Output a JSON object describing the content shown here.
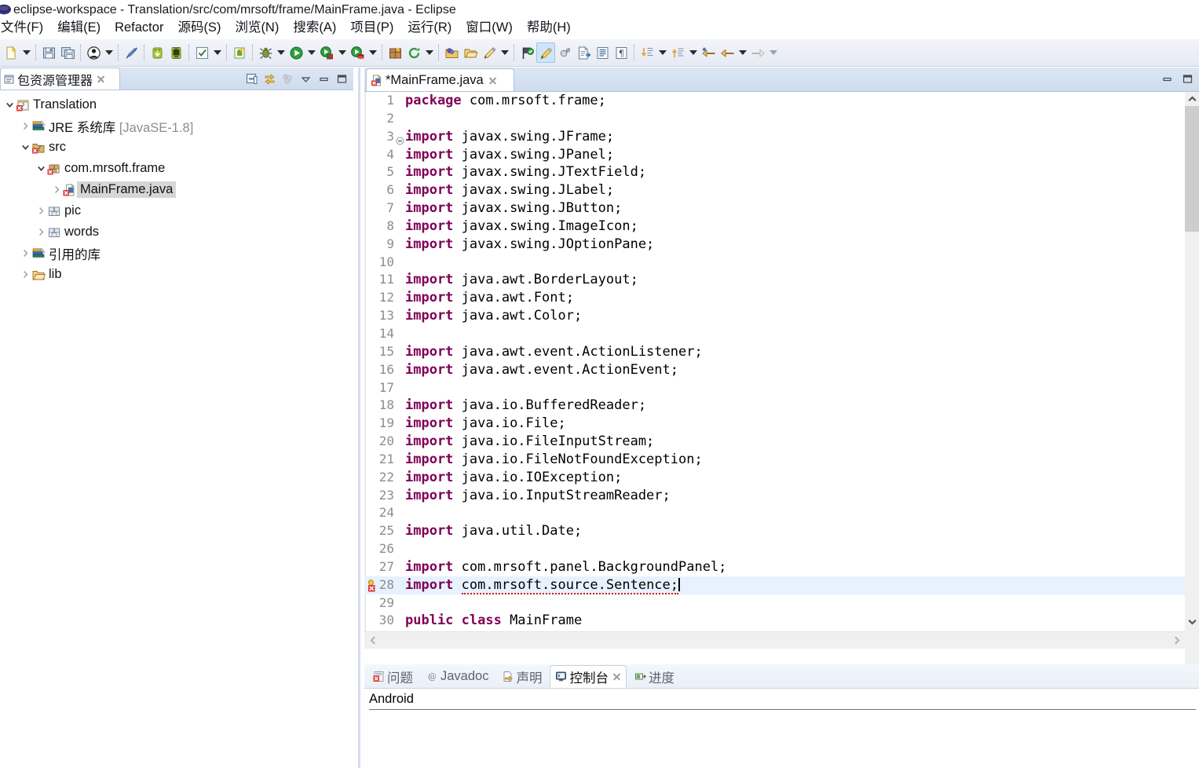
{
  "window": {
    "title": "eclipse-workspace - Translation/src/com/mrsoft/frame/MainFrame.java - Eclipse",
    "logo_icon": "eclipse-logo-icon"
  },
  "menubar": {
    "items": [
      {
        "label": "文件(F)",
        "name": "menu-file"
      },
      {
        "label": "编辑(E)",
        "name": "menu-edit"
      },
      {
        "label": "Refactor",
        "name": "menu-refactor"
      },
      {
        "label": "源码(S)",
        "name": "menu-source"
      },
      {
        "label": "浏览(N)",
        "name": "menu-navigate"
      },
      {
        "label": "搜索(A)",
        "name": "menu-search"
      },
      {
        "label": "项目(P)",
        "name": "menu-project"
      },
      {
        "label": "运行(R)",
        "name": "menu-run"
      },
      {
        "label": "窗口(W)",
        "name": "menu-window"
      },
      {
        "label": "帮助(H)",
        "name": "menu-help"
      }
    ]
  },
  "toolbar": {
    "items": [
      {
        "name": "new-wizard-icon",
        "kind": "icon",
        "icon": "new-file"
      },
      {
        "name": "new-wizard-dropdown",
        "kind": "arrow"
      },
      {
        "name": "sep-1",
        "kind": "sep"
      },
      {
        "name": "save-icon",
        "kind": "icon",
        "icon": "save"
      },
      {
        "name": "save-all-icon",
        "kind": "icon",
        "icon": "save-all"
      },
      {
        "name": "sep-2",
        "kind": "sep"
      },
      {
        "name": "person-icon",
        "kind": "icon",
        "icon": "person"
      },
      {
        "name": "person-dropdown",
        "kind": "arrow"
      },
      {
        "name": "sep-3",
        "kind": "sep"
      },
      {
        "name": "no-pencil-icon",
        "kind": "icon",
        "icon": "pencil-strike"
      },
      {
        "name": "sep-4",
        "kind": "sep"
      },
      {
        "name": "android-sdk-manager-icon",
        "kind": "icon",
        "icon": "android-down"
      },
      {
        "name": "android-avd-manager-icon",
        "kind": "icon",
        "icon": "android-device"
      },
      {
        "name": "sep-5",
        "kind": "sep"
      },
      {
        "name": "check-icon",
        "kind": "icon",
        "icon": "checkbox"
      },
      {
        "name": "check-dropdown",
        "kind": "arrow"
      },
      {
        "name": "sep-6",
        "kind": "sep"
      },
      {
        "name": "new-android-icon",
        "kind": "icon",
        "icon": "new-android"
      },
      {
        "name": "sep-7",
        "kind": "sep"
      },
      {
        "name": "debug-icon",
        "kind": "icon",
        "icon": "bug"
      },
      {
        "name": "debug-dropdown",
        "kind": "arrow"
      },
      {
        "name": "run-icon",
        "kind": "icon",
        "icon": "run"
      },
      {
        "name": "run-dropdown",
        "kind": "arrow"
      },
      {
        "name": "run-external-icon",
        "kind": "icon",
        "icon": "run-green-red"
      },
      {
        "name": "run-external-dropdown",
        "kind": "arrow"
      },
      {
        "name": "run-server-icon",
        "kind": "icon",
        "icon": "run-green-db"
      },
      {
        "name": "run-server-dropdown",
        "kind": "arrow"
      },
      {
        "name": "sep-8",
        "kind": "sep"
      },
      {
        "name": "new-package-icon",
        "kind": "icon",
        "icon": "package-box"
      },
      {
        "name": "refresh-icon",
        "kind": "icon",
        "icon": "refresh-green"
      },
      {
        "name": "refresh-dropdown",
        "kind": "arrow"
      },
      {
        "name": "sep-9",
        "kind": "sep"
      },
      {
        "name": "open-type-icon",
        "kind": "icon",
        "icon": "folder-ball"
      },
      {
        "name": "open-task-icon",
        "kind": "icon",
        "icon": "folder-open"
      },
      {
        "name": "pencil-icon",
        "kind": "icon",
        "icon": "pencil"
      },
      {
        "name": "pencil-dropdown",
        "kind": "arrow"
      },
      {
        "name": "sep-10",
        "kind": "sep"
      },
      {
        "name": "search-type-icon",
        "kind": "icon",
        "icon": "flag-green"
      },
      {
        "name": "marker-icon",
        "kind": "icon",
        "icon": "marker",
        "selected": true
      },
      {
        "name": "toggle-mark-icon",
        "kind": "icon",
        "icon": "toggle-mark"
      },
      {
        "name": "next-annotation-icon",
        "kind": "icon",
        "icon": "doc-arrow"
      },
      {
        "name": "show-whitespace-icon",
        "kind": "icon",
        "icon": "doc-lines"
      },
      {
        "name": "pilcrow-icon",
        "kind": "icon",
        "icon": "pilcrow"
      },
      {
        "name": "sep-11",
        "kind": "sep"
      },
      {
        "name": "next-member-icon",
        "kind": "icon",
        "icon": "down-arrow-list"
      },
      {
        "name": "next-member-dropdown",
        "kind": "arrow"
      },
      {
        "name": "prev-member-icon",
        "kind": "icon",
        "icon": "up-arrow-list"
      },
      {
        "name": "prev-member-dropdown",
        "kind": "arrow"
      },
      {
        "name": "last-edit-icon",
        "kind": "icon",
        "icon": "back-star"
      },
      {
        "name": "back-icon",
        "kind": "icon",
        "icon": "back-arrow"
      },
      {
        "name": "back-dropdown",
        "kind": "arrow"
      },
      {
        "name": "forward-icon",
        "kind": "icon",
        "icon": "forward-arrow-gray"
      },
      {
        "name": "forward-dropdown",
        "kind": "arrow-light"
      }
    ]
  },
  "sidebar": {
    "tab": {
      "label": "包资源管理器",
      "icon": "package-explorer-icon"
    },
    "view_tools": [
      {
        "name": "collapse-all-icon"
      },
      {
        "name": "link-with-editor-icon"
      },
      {
        "name": "focus-on-active-task-icon"
      },
      {
        "name": "view-menu-icon"
      },
      {
        "name": "minimize-icon"
      },
      {
        "name": "maximize-icon"
      }
    ],
    "tree": [
      {
        "label": "Translation",
        "suffix": "",
        "indent": 0,
        "twisty": "down",
        "icon": "java-project-icon",
        "selected": false
      },
      {
        "label": "JRE 系统库 ",
        "suffix": "[JavaSE-1.8]",
        "indent": 1,
        "twisty": "right",
        "icon": "library-icon",
        "selected": false
      },
      {
        "label": "src",
        "suffix": "",
        "indent": 1,
        "twisty": "down",
        "icon": "source-folder-icon",
        "selected": false
      },
      {
        "label": "com.mrsoft.frame",
        "suffix": "",
        "indent": 2,
        "twisty": "down",
        "icon": "package-icon",
        "selected": false
      },
      {
        "label": "MainFrame.java",
        "suffix": "",
        "indent": 3,
        "twisty": "right",
        "icon": "java-file-error-icon",
        "selected": true
      },
      {
        "label": "pic",
        "suffix": "",
        "indent": 2,
        "twisty": "right",
        "icon": "folder-pkg-icon",
        "selected": false
      },
      {
        "label": "words",
        "suffix": "",
        "indent": 2,
        "twisty": "right",
        "icon": "folder-pkg-icon",
        "selected": false
      },
      {
        "label": "引用的库",
        "suffix": "",
        "indent": 1,
        "twisty": "right",
        "icon": "library-icon",
        "selected": false
      },
      {
        "label": "lib",
        "suffix": "",
        "indent": 1,
        "twisty": "right",
        "icon": "folder-icon",
        "selected": false
      }
    ]
  },
  "editor": {
    "tab": {
      "label": "*MainFrame.java",
      "icon": "java-file-error-icon"
    },
    "view_tools": [
      {
        "name": "minimize-icon"
      },
      {
        "name": "maximize-icon"
      }
    ],
    "lines": [
      {
        "n": "1",
        "tokens": [
          {
            "t": "package",
            "k": true
          },
          {
            "t": " com.mrsoft.frame;",
            "k": false
          }
        ],
        "fold": "",
        "marker": "",
        "current": false
      },
      {
        "n": "2",
        "tokens": [],
        "fold": "",
        "marker": "",
        "current": false
      },
      {
        "n": "3",
        "tokens": [
          {
            "t": "import",
            "k": true
          },
          {
            "t": " javax.swing.JFrame;",
            "k": false
          }
        ],
        "fold": "collapse",
        "marker": "",
        "current": false
      },
      {
        "n": "4",
        "tokens": [
          {
            "t": "import",
            "k": true
          },
          {
            "t": " javax.swing.JPanel;",
            "k": false
          }
        ],
        "fold": "",
        "marker": "",
        "current": false
      },
      {
        "n": "5",
        "tokens": [
          {
            "t": "import",
            "k": true
          },
          {
            "t": " javax.swing.JTextField;",
            "k": false
          }
        ],
        "fold": "",
        "marker": "",
        "current": false
      },
      {
        "n": "6",
        "tokens": [
          {
            "t": "import",
            "k": true
          },
          {
            "t": " javax.swing.JLabel;",
            "k": false
          }
        ],
        "fold": "",
        "marker": "",
        "current": false
      },
      {
        "n": "7",
        "tokens": [
          {
            "t": "import",
            "k": true
          },
          {
            "t": " javax.swing.JButton;",
            "k": false
          }
        ],
        "fold": "",
        "marker": "",
        "current": false
      },
      {
        "n": "8",
        "tokens": [
          {
            "t": "import",
            "k": true
          },
          {
            "t": " javax.swing.ImageIcon;",
            "k": false
          }
        ],
        "fold": "",
        "marker": "",
        "current": false
      },
      {
        "n": "9",
        "tokens": [
          {
            "t": "import",
            "k": true
          },
          {
            "t": " javax.swing.JOptionPane;",
            "k": false
          }
        ],
        "fold": "",
        "marker": "",
        "current": false
      },
      {
        "n": "10",
        "tokens": [],
        "fold": "",
        "marker": "",
        "current": false
      },
      {
        "n": "11",
        "tokens": [
          {
            "t": "import",
            "k": true
          },
          {
            "t": " java.awt.BorderLayout;",
            "k": false
          }
        ],
        "fold": "",
        "marker": "",
        "current": false
      },
      {
        "n": "12",
        "tokens": [
          {
            "t": "import",
            "k": true
          },
          {
            "t": " java.awt.Font;",
            "k": false
          }
        ],
        "fold": "",
        "marker": "",
        "current": false
      },
      {
        "n": "13",
        "tokens": [
          {
            "t": "import",
            "k": true
          },
          {
            "t": " java.awt.Color;",
            "k": false
          }
        ],
        "fold": "",
        "marker": "",
        "current": false
      },
      {
        "n": "14",
        "tokens": [],
        "fold": "",
        "marker": "",
        "current": false
      },
      {
        "n": "15",
        "tokens": [
          {
            "t": "import",
            "k": true
          },
          {
            "t": " java.awt.event.ActionListener;",
            "k": false
          }
        ],
        "fold": "",
        "marker": "",
        "current": false
      },
      {
        "n": "16",
        "tokens": [
          {
            "t": "import",
            "k": true
          },
          {
            "t": " java.awt.event.ActionEvent;",
            "k": false
          }
        ],
        "fold": "",
        "marker": "",
        "current": false
      },
      {
        "n": "17",
        "tokens": [],
        "fold": "",
        "marker": "",
        "current": false
      },
      {
        "n": "18",
        "tokens": [
          {
            "t": "import",
            "k": true
          },
          {
            "t": " java.io.BufferedReader;",
            "k": false
          }
        ],
        "fold": "",
        "marker": "",
        "current": false
      },
      {
        "n": "19",
        "tokens": [
          {
            "t": "import",
            "k": true
          },
          {
            "t": " java.io.File;",
            "k": false
          }
        ],
        "fold": "",
        "marker": "",
        "current": false
      },
      {
        "n": "20",
        "tokens": [
          {
            "t": "import",
            "k": true
          },
          {
            "t": " java.io.FileInputStream;",
            "k": false
          }
        ],
        "fold": "",
        "marker": "",
        "current": false
      },
      {
        "n": "21",
        "tokens": [
          {
            "t": "import",
            "k": true
          },
          {
            "t": " java.io.FileNotFoundException;",
            "k": false
          }
        ],
        "fold": "",
        "marker": "",
        "current": false
      },
      {
        "n": "22",
        "tokens": [
          {
            "t": "import",
            "k": true
          },
          {
            "t": " java.io.IOException;",
            "k": false
          }
        ],
        "fold": "",
        "marker": "",
        "current": false
      },
      {
        "n": "23",
        "tokens": [
          {
            "t": "import",
            "k": true
          },
          {
            "t": " java.io.InputStreamReader;",
            "k": false
          }
        ],
        "fold": "",
        "marker": "",
        "current": false
      },
      {
        "n": "24",
        "tokens": [],
        "fold": "",
        "marker": "",
        "current": false
      },
      {
        "n": "25",
        "tokens": [
          {
            "t": "import",
            "k": true
          },
          {
            "t": " java.util.Date;",
            "k": false
          }
        ],
        "fold": "",
        "marker": "",
        "current": false
      },
      {
        "n": "26",
        "tokens": [],
        "fold": "",
        "marker": "",
        "current": false
      },
      {
        "n": "27",
        "tokens": [
          {
            "t": "import",
            "k": true
          },
          {
            "t": " com.mrsoft.panel.BackgroundPanel;",
            "k": false
          }
        ],
        "fold": "",
        "marker": "",
        "current": false
      },
      {
        "n": "28",
        "tokens": [
          {
            "t": "import",
            "k": true
          },
          {
            "t": " ",
            "k": false
          },
          {
            "t": "com.mrsoft.source.Sentence;",
            "k": false,
            "err": true
          }
        ],
        "fold": "",
        "marker": "quickfix-error-icon",
        "current": true,
        "caret": true
      },
      {
        "n": "29",
        "tokens": [],
        "fold": "",
        "marker": "",
        "current": false
      },
      {
        "n": "30",
        "tokens": [
          {
            "t": "public class",
            "k": true
          },
          {
            "t": " MainFrame",
            "k": false
          }
        ],
        "fold": "",
        "marker": "",
        "current": false
      }
    ]
  },
  "bottom_panel": {
    "tabs": [
      {
        "label": "问题",
        "icon": "problems-icon",
        "active": false
      },
      {
        "label": "Javadoc",
        "icon": "javadoc-icon",
        "active": false
      },
      {
        "label": "声明",
        "icon": "declaration-icon",
        "active": false
      },
      {
        "label": "控制台",
        "icon": "console-icon",
        "active": true,
        "closable": true
      },
      {
        "label": "进度",
        "icon": "progress-icon",
        "active": false
      }
    ],
    "console_title": "Android"
  },
  "colors": {
    "keyword": "#7f0055",
    "line_number": "#8d8d8d",
    "current_line": "#e8f2fe",
    "tab_active_bg": "#ffffff",
    "tab_bar_bg": "#cfdcee",
    "error_underline": "#d01a1a",
    "selection": "#d6d6d6"
  }
}
